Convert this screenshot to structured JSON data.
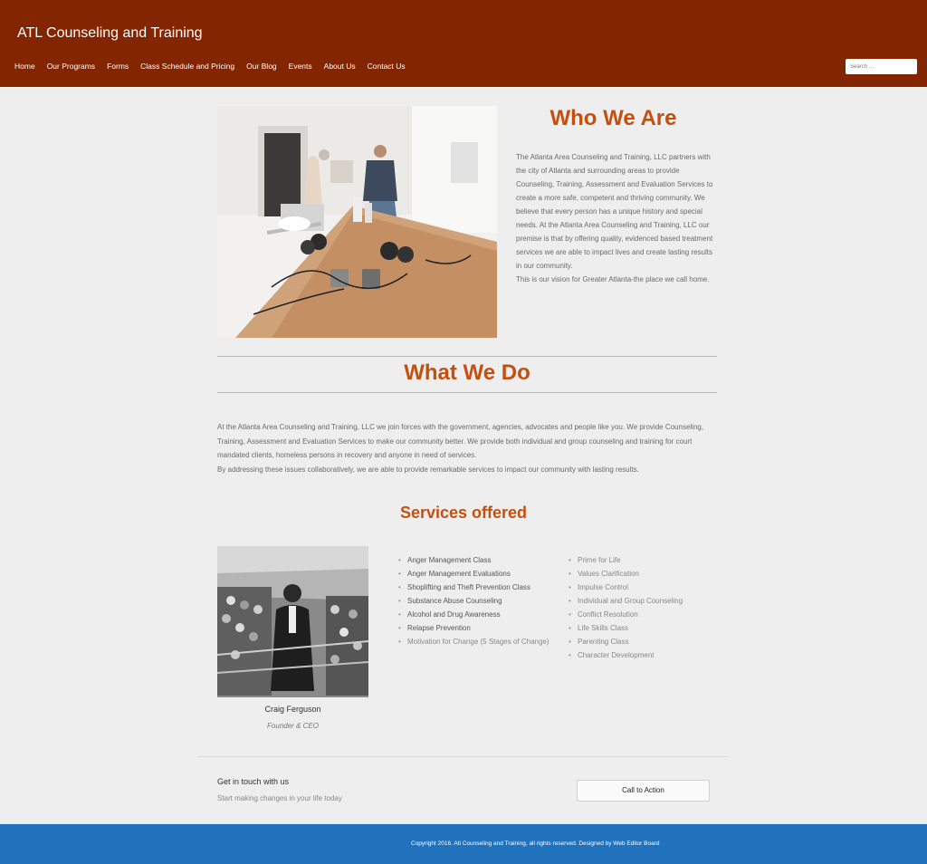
{
  "header": {
    "site_title": "ATL Counseling and Training",
    "nav": [
      "Home",
      "Our Programs",
      "Forms",
      "Class Schedule and Pricing",
      "Our Blog",
      "Events",
      "About Us",
      "Contact Us"
    ],
    "search_placeholder": "Search …"
  },
  "who": {
    "heading": "Who We Are",
    "paragraph": "The Atlanta Area Counseling and Training, LLC partners with the city of Atlanta and surrounding areas to provide Counseling, Training, Assessment and Evaluation Services to create a more safe, competent and thriving community. We believe that every person has a unique history and special needs. At the Atlanta Area Counseling and Training, LLC our premise is that by offering quality, evidenced based treatment services we are able to impact lives and create lasting results in our community.",
    "vision": "This is our vision for Greater Atlanta-the place we call home."
  },
  "what": {
    "heading": "What We Do",
    "paragraph": "At the Atlanta Area Counseling and Training, LLC we join forces with the government, agencies, advocates and people like you. We provide Counseling, Training, Assessment and Evaluation Services to make our community better. We provide both individual and group counseling and training for court mandated clients, homeless persons in recovery and anyone in need of services.",
    "paragraph2": "By addressing these issues collaboratively, we are able to provide remarkable services to impact our community with lasting results."
  },
  "services": {
    "heading": "Services offered",
    "person_name": "Craig Ferguson",
    "person_role": "Founder & CEO",
    "list1": [
      "Anger Management Class",
      "Anger Management Evaluations",
      "Shoplifting and Theft Prevention Class",
      "Substance Abuse Counseling",
      "Alcohol and Drug Awareness",
      "Relapse Prevention",
      "Motivation for Change (5 Stages of Change)"
    ],
    "list2": [
      "Prime for Life",
      "Values Clarification",
      "Impulse Control",
      "Individual and Group Counseling",
      "Conflict Resolution",
      "Life Skills Class",
      "Parenting Class",
      "Character Development"
    ]
  },
  "cta": {
    "title": "Get in touch with us",
    "subtitle": "Start making changes in your life today",
    "button": "Call to Action"
  },
  "footer": {
    "copyright": "Copyright 2016. Atl Counseling and Training, all rights reserved. Designed by Web Editor Board"
  }
}
